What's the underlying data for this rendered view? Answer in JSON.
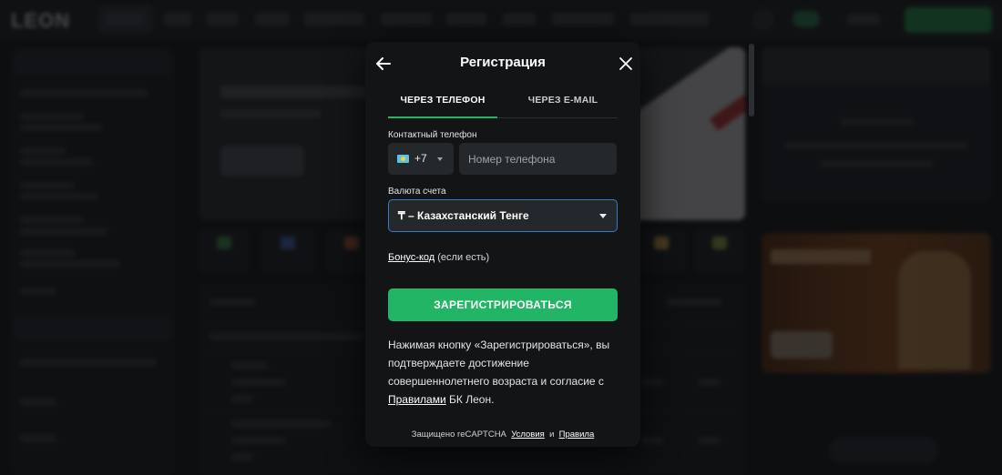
{
  "background": {
    "logo": "LEON"
  },
  "modal": {
    "title": "Регистрация",
    "tabs": [
      {
        "label": "ЧЕРЕЗ ТЕЛЕФОН",
        "active": true
      },
      {
        "label": "ЧЕРЕЗ E-MAIL",
        "active": false
      }
    ],
    "phone": {
      "label": "Контактный телефон",
      "country_code": "+7",
      "placeholder": "Номер телефона",
      "value": ""
    },
    "currency": {
      "label": "Валюта счета",
      "selected": "₸ – Казахстанский Тенге"
    },
    "bonus": {
      "link": "Бонус-код",
      "suffix": " (если есть)"
    },
    "submit_label": "ЗАРЕГИСТРИРОВАТЬСЯ",
    "terms": {
      "text_before": "Нажимая кнопку «Зарегистрироваться», вы подтверждаете достижение совершеннолетнего возраста и согласие с ",
      "link": "Правилами",
      "text_after": " БК Леон."
    },
    "captcha": {
      "prefix": "Защищено reCAPTCHA",
      "terms_link": "Условия",
      "and": "и",
      "rules_link": "Правила"
    }
  },
  "colors": {
    "accent_green": "#22b566",
    "focus_blue": "#3b78c4",
    "modal_bg": "#121416",
    "field_bg": "#25282b"
  },
  "icons": [
    "back-arrow-icon",
    "close-icon",
    "kazakhstan-flag-icon",
    "chevron-down-icon"
  ]
}
